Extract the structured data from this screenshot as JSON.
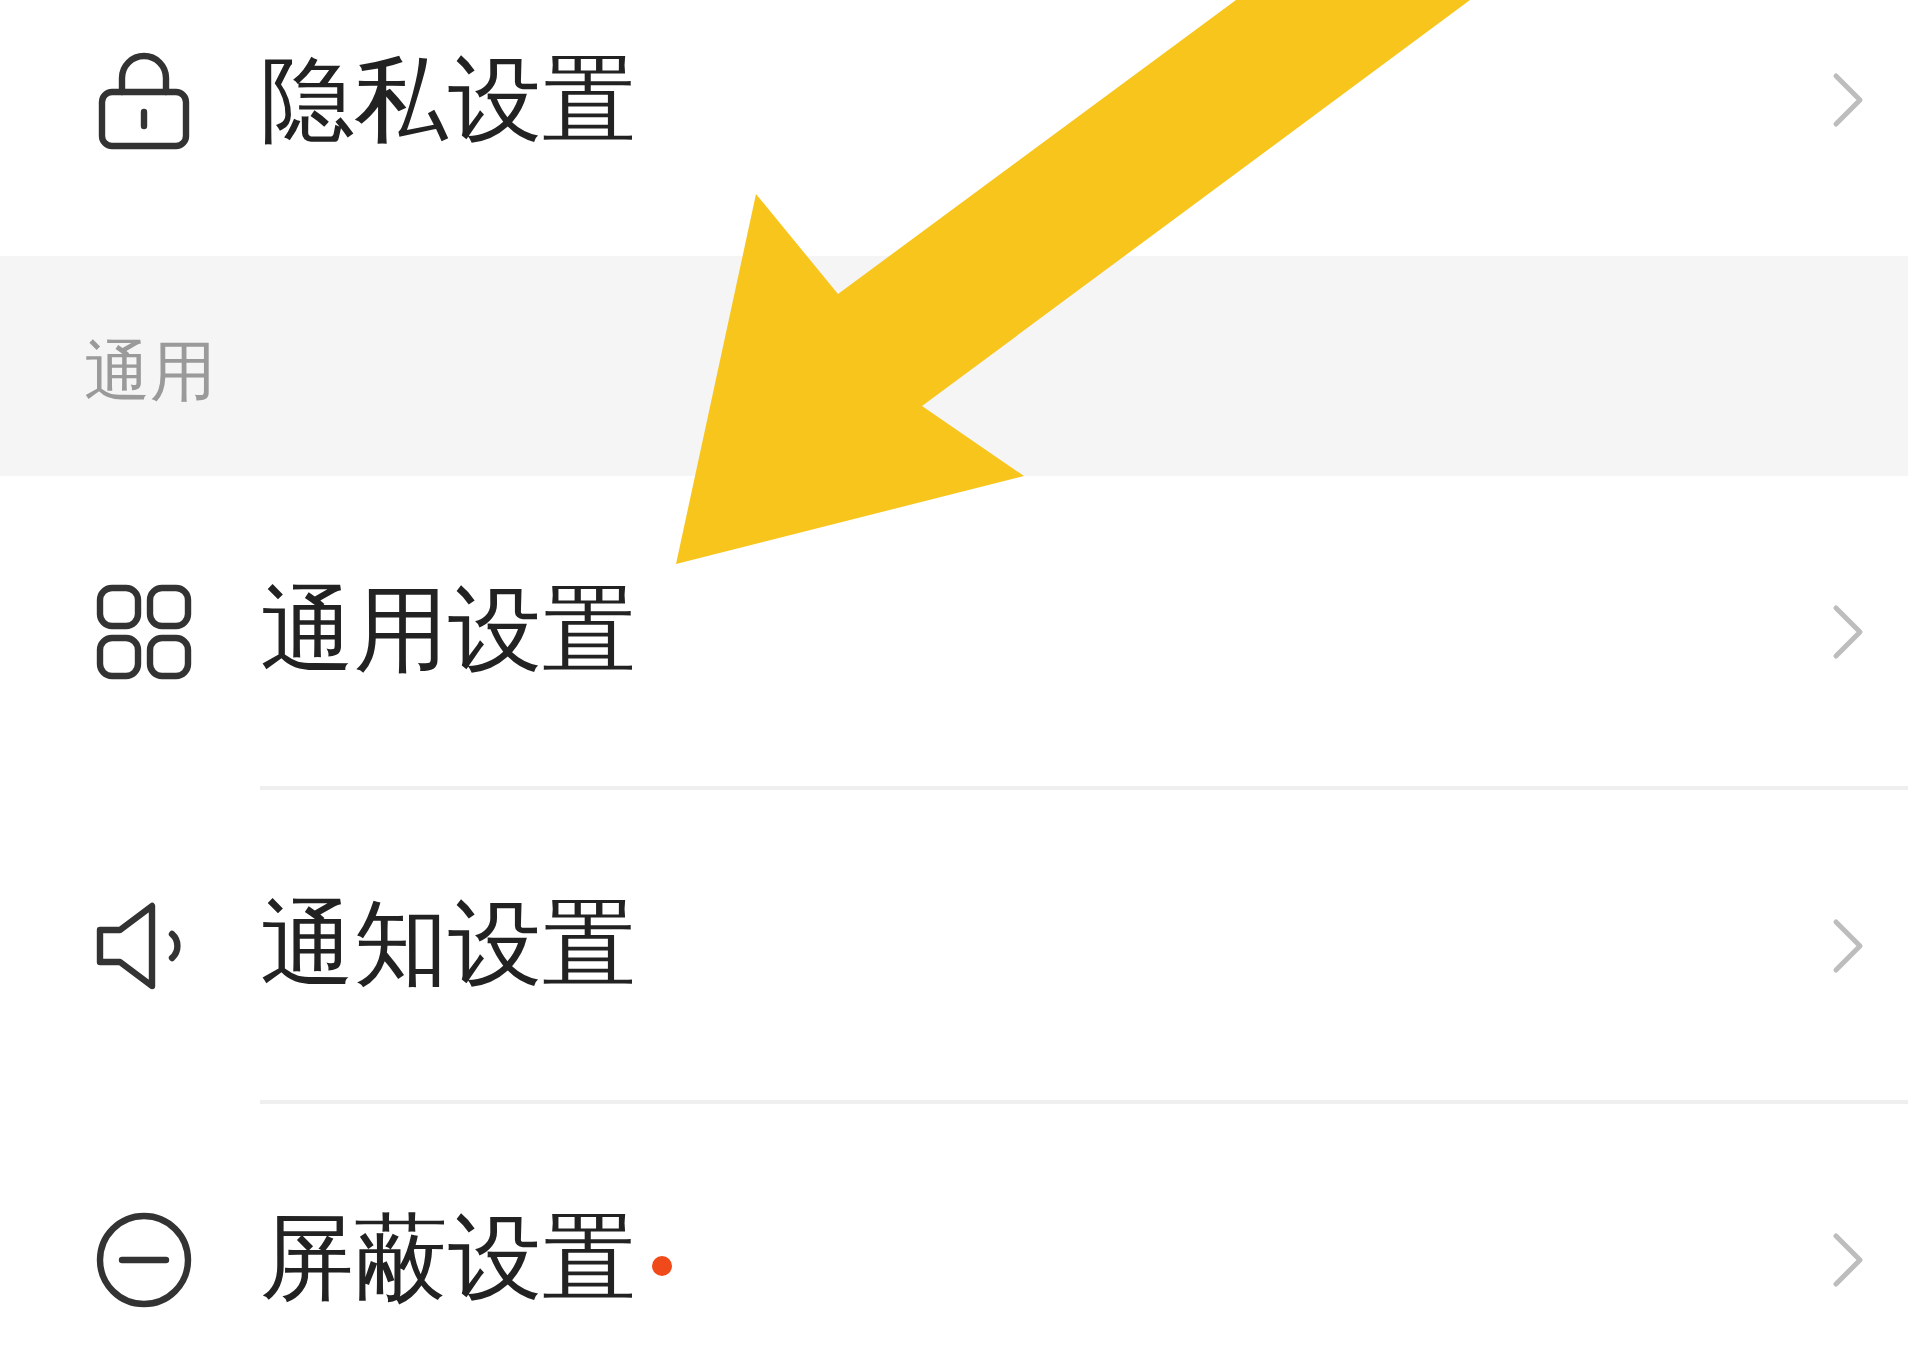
{
  "sections": [
    {
      "items": [
        {
          "label": "隐私设置",
          "dot": false
        }
      ]
    },
    {
      "title": "通用",
      "items": [
        {
          "label": "通用设置",
          "dot": false
        },
        {
          "label": "通知设置",
          "dot": false
        },
        {
          "label": "屏蔽设置",
          "dot": true
        }
      ]
    }
  ]
}
